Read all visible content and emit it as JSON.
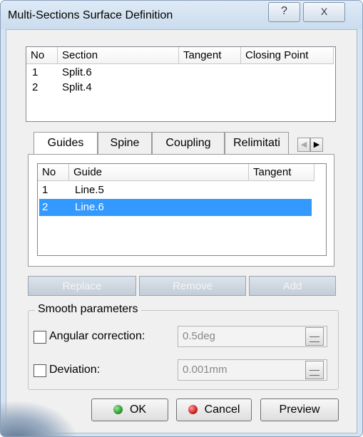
{
  "window": {
    "title": "Multi-Sections Surface Definition",
    "help_glyph": "?",
    "close_glyph": "X"
  },
  "sections_table": {
    "columns": [
      "No",
      "Section",
      "Tangent",
      "Closing Point"
    ],
    "rows": [
      {
        "no": "1",
        "section": "Split.6"
      },
      {
        "no": "2",
        "section": "Split.4"
      }
    ]
  },
  "tabs": {
    "items": [
      "Guides",
      "Spine",
      "Coupling",
      "Relimitati"
    ],
    "active": "Guides",
    "scroll_left_glyph": "◀",
    "scroll_right_glyph": "▶"
  },
  "guides_table": {
    "columns": [
      "No",
      "Guide",
      "Tangent"
    ],
    "rows": [
      {
        "no": "1",
        "guide": "Line.5",
        "selected": false
      },
      {
        "no": "2",
        "guide": "Line.6",
        "selected": true
      }
    ]
  },
  "actions": {
    "replace": "Replace",
    "remove": "Remove",
    "add": "Add",
    "state": "disabled"
  },
  "smooth": {
    "title": "Smooth parameters",
    "angular_label": "Angular correction:",
    "angular_value": "0.5deg",
    "angular_checked": false,
    "deviation_label": "Deviation:",
    "deviation_value": "0.001mm",
    "deviation_checked": false
  },
  "footer": {
    "ok": "OK",
    "cancel": "Cancel",
    "preview": "Preview"
  },
  "colors": {
    "selection": "#3399ff",
    "ok_icon": "#2e9c2e",
    "cancel_icon": "#cc2222"
  }
}
